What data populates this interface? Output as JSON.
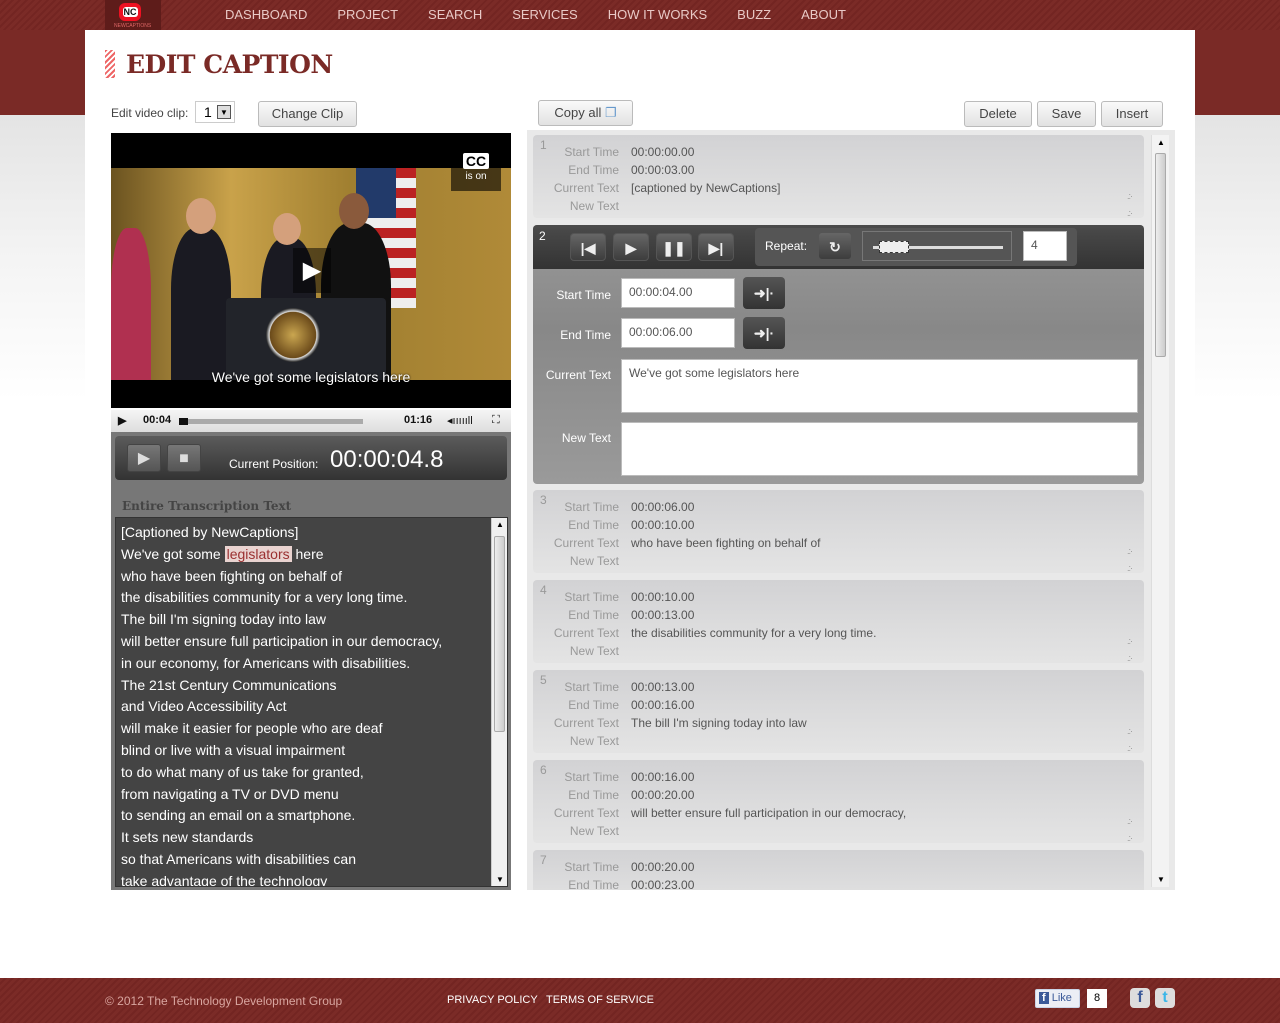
{
  "nav": {
    "logo_text": "NC",
    "logo_sub": "NEWCAPTIONS",
    "items": [
      "DASHBOARD",
      "PROJECT",
      "SEARCH",
      "SERVICES",
      "HOW IT WORKS",
      "BUZZ",
      "ABOUT"
    ]
  },
  "page_title": "EDIT CAPTION",
  "clip": {
    "label": "Edit video clip:",
    "value": "1",
    "change_label": "Change Clip"
  },
  "toolbar": {
    "copy_all": "Copy all",
    "delete": "Delete",
    "save": "Save",
    "insert": "Insert"
  },
  "video": {
    "cc_badge": "CC",
    "cc_status": "is on",
    "subtitle": "We've got some legislators here",
    "current_time": "00:04",
    "duration": "01:16",
    "progress": 0.05
  },
  "player": {
    "position_label": "Current Position:",
    "position": "00:00:04.8"
  },
  "transcription": {
    "title": "Entire Transcription Text",
    "highlight": "legislators",
    "lines": [
      "[Captioned by NewCaptions]",
      "We've got some legislators here",
      "who have been fighting on behalf of",
      "the disabilities community for a very long time.",
      "The bill I'm signing today into law",
      "will better ensure full participation in our democracy,",
      "in our economy, for Americans with disabilities.",
      "The 21st Century Communications",
      "and Video Accessibility Act",
      "will make it easier for people who are deaf",
      "blind or live with a visual impairment",
      "to do what many of us take for granted,",
      "from navigating a TV or DVD menu",
      "to sending an email on a smartphone.",
      "It sets new standards",
      "so that Americans with disabilities can",
      "take advantage of the technology"
    ]
  },
  "labels": {
    "start": "Start Time",
    "end": "End Time",
    "current": "Current Text",
    "new": "New Text",
    "repeat": "Repeat:"
  },
  "active": {
    "number": "2",
    "start": "00:00:04.00",
    "end": "00:00:06.00",
    "current_text": "We've got some legislators here",
    "new_text": "",
    "repeat_count": "4"
  },
  "captions": [
    {
      "number": "1",
      "start": "00:00:00.00",
      "end": "00:00:03.00",
      "text": "[captioned by NewCaptions]"
    },
    {
      "number": "3",
      "start": "00:00:06.00",
      "end": "00:00:10.00",
      "text": "who have been fighting on behalf of"
    },
    {
      "number": "4",
      "start": "00:00:10.00",
      "end": "00:00:13.00",
      "text": "the disabilities community for a very long time."
    },
    {
      "number": "5",
      "start": "00:00:13.00",
      "end": "00:00:16.00",
      "text": "The bill I'm signing today into law"
    },
    {
      "number": "6",
      "start": "00:00:16.00",
      "end": "00:00:20.00",
      "text": "will better ensure full participation in our democracy,"
    },
    {
      "number": "7",
      "start": "00:00:20.00",
      "end": "00:00:23.00",
      "text": ""
    }
  ],
  "footer": {
    "copyright": "© 2012 The Technology Development Group",
    "privacy": "PRIVACY POLICY",
    "terms": "TERMS OF SERVICE",
    "like": "Like",
    "like_count": "8"
  },
  "colors": {
    "brand": "#7a2a26",
    "highlight": "#e9d3d0"
  }
}
